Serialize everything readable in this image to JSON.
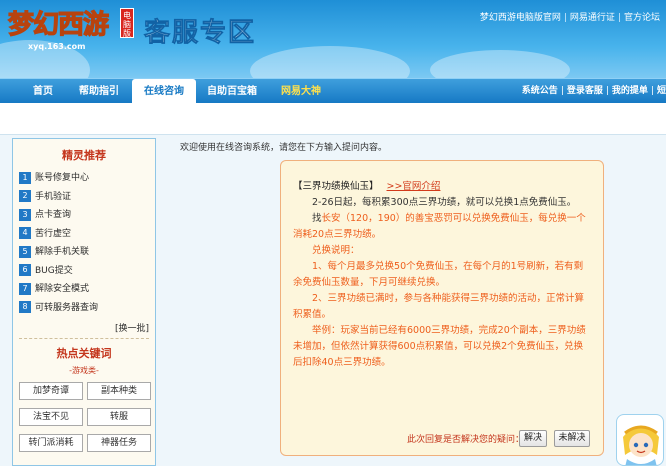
{
  "header": {
    "logo_text": "梦幻西游",
    "logo_badge": "电脑版",
    "logo_url": "xyq.163.com",
    "site_title": "客服专区",
    "top_links": [
      "梦幻西游电脑版官网",
      "网易通行证",
      "官方论坛"
    ]
  },
  "nav": {
    "items": [
      {
        "label": "首页"
      },
      {
        "label": "帮助指引"
      },
      {
        "label": "在线咨询"
      },
      {
        "label": "自助百宝箱"
      },
      {
        "label": "网易大神"
      }
    ],
    "right_links": [
      "系统公告",
      "登录客服",
      "我的提单",
      "短"
    ]
  },
  "sidebar": {
    "recommend_title": "精灵推荐",
    "items": [
      {
        "num": "1",
        "label": "账号修复中心"
      },
      {
        "num": "2",
        "label": "手机验证"
      },
      {
        "num": "3",
        "label": "点卡查询"
      },
      {
        "num": "4",
        "label": "苦行虚空"
      },
      {
        "num": "5",
        "label": "解除手机关联"
      },
      {
        "num": "6",
        "label": "BUG提交"
      },
      {
        "num": "7",
        "label": "解除安全模式"
      },
      {
        "num": "8",
        "label": "可转服务器查询"
      }
    ],
    "refresh_label": "[换一批]",
    "hot_title": "热点关键词",
    "category_label": "-游戏类-",
    "keywords": [
      "加梦奇谭",
      "副本种类",
      "法宝不见",
      "转服",
      "转门派消耗",
      "神器任务"
    ]
  },
  "main": {
    "welcome": "欢迎使用在线咨询系统，请您在下方输入提问内容。",
    "answer": {
      "title": "【三界功绩换仙玉】",
      "title_link": ">>官网介绍",
      "p1": "2-26日起，每积累300点三界功绩，就可以兑换1点免费仙玉。",
      "p2_prefix": "找",
      "p2_highlight": "长安（120，190）的善宝恶罚可以兑换免费仙玉，每兑换一个消耗20点三界功绩。",
      "heading": "兑换说明：",
      "rule1": "1、每个月最多兑换50个免费仙玉，在每个月的1号刷新，若有剩余免费仙玉数量，下月可继续兑换。",
      "rule2": "2、三界功绩已满时，参与各种能获得三界功绩的活动，正常计算积累值。",
      "example": "举例：玩家当前已经有6000三界功绩，完成20个副本，三界功绩未增加，但依然计算获得600点积累值，可以兑换2个免费仙玉，兑换后扣除40点三界功绩。"
    },
    "feedback": {
      "question": "此次回复是否解决您的疑问：",
      "yes_label": "解决",
      "no_label": "未解决"
    }
  }
}
